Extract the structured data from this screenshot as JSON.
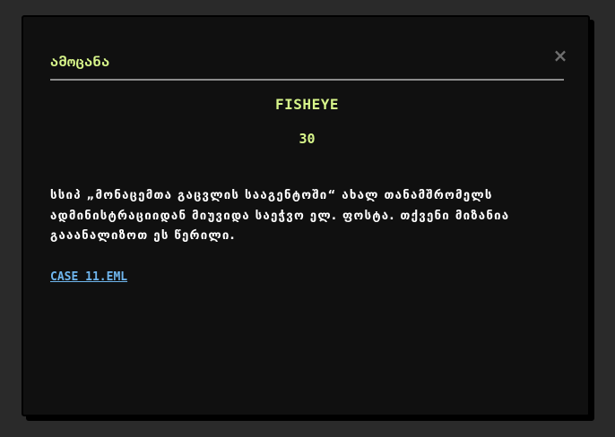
{
  "modal": {
    "title": "ამოცანა",
    "close_glyph": "×",
    "challenge_name": "FISHEYE",
    "points": "30",
    "description": "სსიპ „მონაცემთა გაცვლის სააგენტოში“ ახალ თანამშრომელს ადმინისტრაციიდან მიუვიდა საეჭვო ელ. ფოსტა. თქვენი მიზანია გააანალიზოთ ეს წერილი.",
    "attachment_link": "CASE 11.EML"
  },
  "colors": {
    "accent_green": "#d7f58a",
    "link_blue": "#6fb6ee",
    "modal_bg": "#101010",
    "page_bg": "#2a2a2a"
  },
  "icons": {
    "close": "close-icon"
  }
}
